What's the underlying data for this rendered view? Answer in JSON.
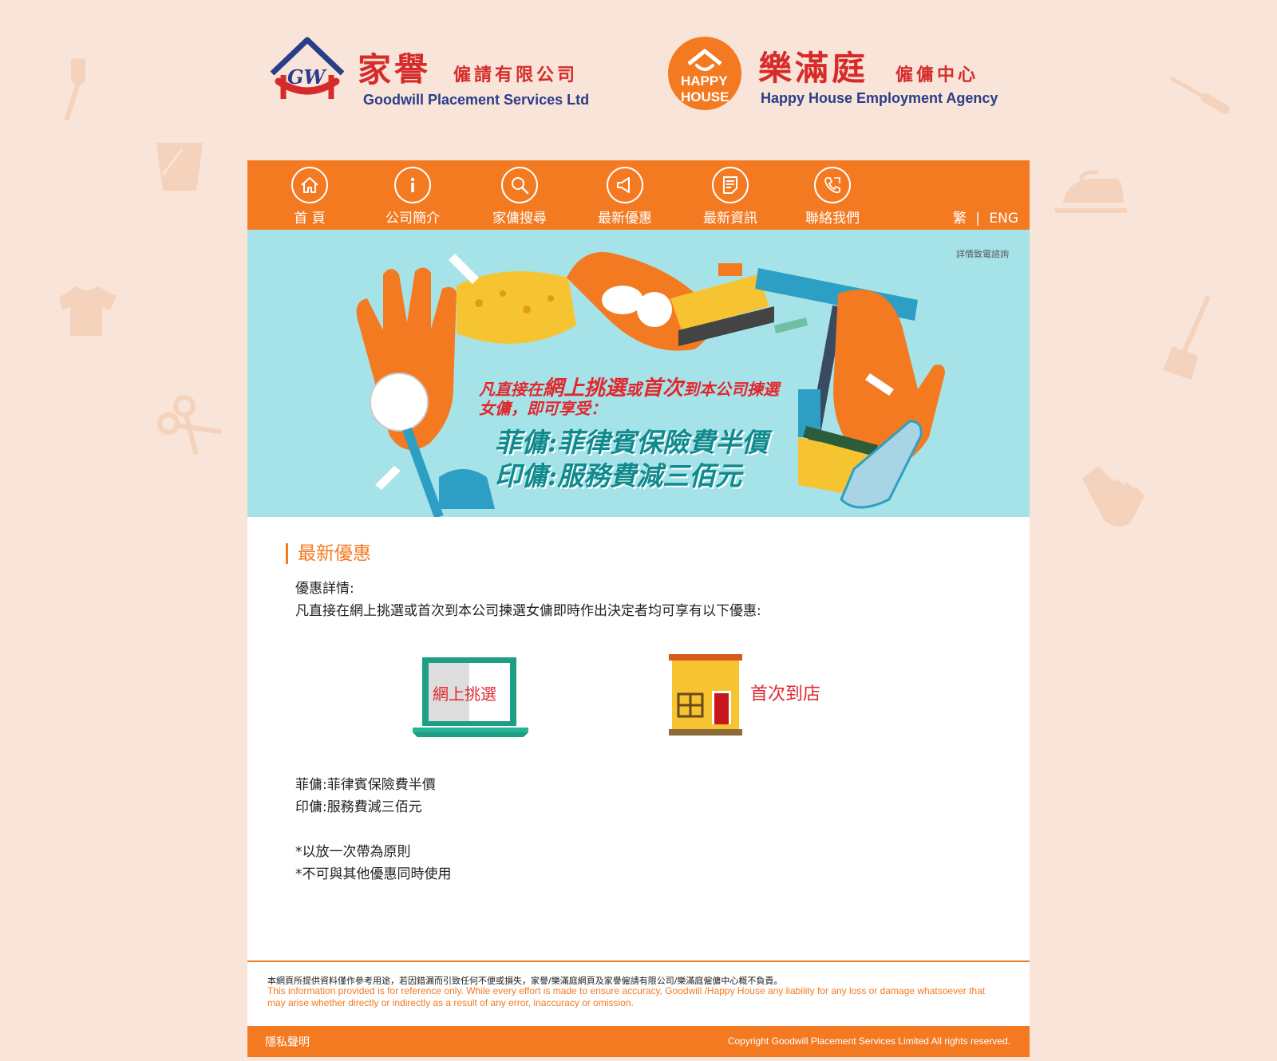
{
  "brand": {
    "goodwill": {
      "cn_name": "家譽",
      "cn_sub": "僱請有限公司",
      "en_name": "Goodwill Placement Services Ltd",
      "logo_text": "GW"
    },
    "happyhouse": {
      "cn_name": "樂滿庭",
      "cn_sub": "僱傭中心",
      "en_name": "Happy House Employment Agency",
      "logo_text_1": "HAPPY",
      "logo_text_2": "HOUSE"
    }
  },
  "nav": {
    "items": [
      {
        "label": "首 頁",
        "icon": "home-icon"
      },
      {
        "label": "公司簡介",
        "icon": "info-icon"
      },
      {
        "label": "家傭搜尋",
        "icon": "search-icon"
      },
      {
        "label": "最新優惠",
        "icon": "megaphone-icon"
      },
      {
        "label": "最新資訊",
        "icon": "news-icon"
      },
      {
        "label": "聯絡我們",
        "icon": "phone-icon"
      }
    ],
    "lang_trad": "繁",
    "lang_sep": "|",
    "lang_eng": "ENG"
  },
  "banner": {
    "note": "詳情致電諮詢",
    "line1_a": "凡直接在",
    "line1_b": "網上挑選",
    "line1_c": "或",
    "line1_d": "首次",
    "line1_e": "到本公司揀選",
    "line2": "女傭，即可享受：",
    "promo1": "菲傭:菲律賓保險費半價",
    "promo2": "印傭:服務費減三佰元"
  },
  "content": {
    "section_title": "最新優惠",
    "detail_label": "優惠詳情:",
    "detail_text": "凡直接在網上挑選或首次到本公司揀選女傭即時作出決定者均可享有以下優惠:",
    "online_label": "網上挑選",
    "store_label": "首次到店",
    "offer1": "菲傭:菲律賓保險費半價",
    "offer2": "印傭:服務費減三佰元",
    "note1": "*以放一次帶為原則",
    "note2": "*不可與其他優惠同時使用"
  },
  "footer": {
    "disclaimer_cn": "本網頁所提供資料僅作參考用途，若因錯漏而引致任何不便或損失，家譽/樂滿庭網頁及家譽僱請有限公司/樂滿庭僱傭中心概不負責。",
    "disclaimer_en": "This information provided is for reference only. While every effort is made to ensure accuracy, Goodwill /Happy House any liability for any loss or damage whatsoever that may arise whether directly or indirectly as a result of any error, inaccuracy or omission.",
    "privacy": "隱私聲明",
    "copyright": "Copyright Goodwill Placement Services Limited All rights reserved."
  },
  "colors": {
    "accent": "#f47a22",
    "background": "#f8e4d8",
    "banner_bg": "#a6e3e9",
    "red_text": "#e0282e",
    "teal_text": "#0f8a8f",
    "brand_blue": "#2a3d8a"
  }
}
